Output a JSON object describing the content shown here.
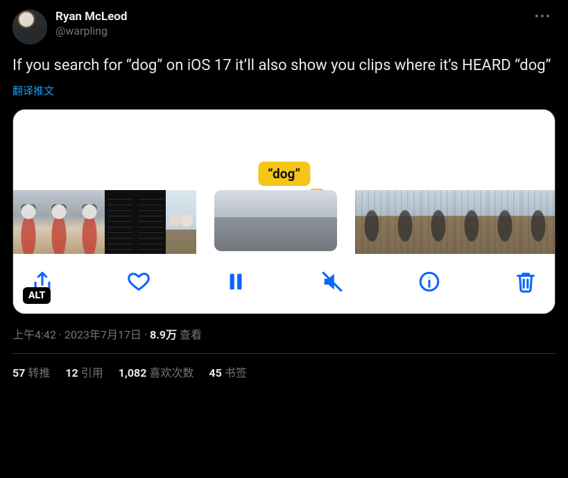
{
  "author": {
    "name": "Ryan McLeod",
    "handle": "@warpling"
  },
  "more_aria": "More",
  "body": "If you search for “dog” on iOS 17 it’ll also show you clips where it’s HEARD “dog”",
  "translate_label": "翻译推文",
  "media": {
    "search_token": "“dog”",
    "alt_badge": "ALT",
    "toolbar": {
      "share": "Share",
      "like": "Like",
      "pause": "Pause",
      "mute": "Muted",
      "info": "Info",
      "delete": "Delete"
    }
  },
  "meta": {
    "time": "上午4:42",
    "dot": " · ",
    "date": "2023年7月17日",
    "views_count": "8.9万",
    "views_label": " 查看"
  },
  "stats": {
    "retweets": {
      "count": "57",
      "label": "转推"
    },
    "quotes": {
      "count": "12",
      "label": "引用"
    },
    "likes": {
      "count": "1,082",
      "label": "喜欢次数"
    },
    "bookmarks": {
      "count": "45",
      "label": "书签"
    }
  }
}
